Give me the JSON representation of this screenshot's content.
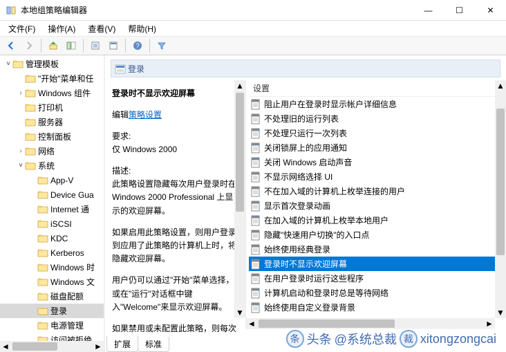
{
  "window": {
    "title": "本地组策略编辑器",
    "controls": {
      "min": "—",
      "max": "☐",
      "close": "✕"
    }
  },
  "menu": [
    {
      "label": "文件(F)"
    },
    {
      "label": "操作(A)"
    },
    {
      "label": "查看(V)"
    },
    {
      "label": "帮助(H)"
    }
  ],
  "toolbar": [
    {
      "name": "back-icon"
    },
    {
      "name": "forward-icon"
    },
    {
      "sep": true
    },
    {
      "name": "up-icon"
    },
    {
      "name": "show-hide-tree-icon"
    },
    {
      "sep": true
    },
    {
      "name": "export-list-icon"
    },
    {
      "name": "properties-icon"
    },
    {
      "sep": true
    },
    {
      "name": "help-icon"
    },
    {
      "sep": true
    },
    {
      "name": "filter-icon"
    }
  ],
  "tree": [
    {
      "indent": 0,
      "twisty": "open",
      "label": "管理模板"
    },
    {
      "indent": 1,
      "twisty": "none",
      "label": "\"开始\"菜单和任"
    },
    {
      "indent": 1,
      "twisty": "closed",
      "label": "Windows 组件"
    },
    {
      "indent": 1,
      "twisty": "none",
      "label": "打印机"
    },
    {
      "indent": 1,
      "twisty": "none",
      "label": "服务器"
    },
    {
      "indent": 1,
      "twisty": "none",
      "label": "控制面板"
    },
    {
      "indent": 1,
      "twisty": "closed",
      "label": "网络"
    },
    {
      "indent": 1,
      "twisty": "open",
      "label": "系统"
    },
    {
      "indent": 2,
      "twisty": "none",
      "label": "App-V"
    },
    {
      "indent": 2,
      "twisty": "none",
      "label": "Device Gua"
    },
    {
      "indent": 2,
      "twisty": "none",
      "label": "Internet 通"
    },
    {
      "indent": 2,
      "twisty": "none",
      "label": "iSCSI"
    },
    {
      "indent": 2,
      "twisty": "none",
      "label": "KDC"
    },
    {
      "indent": 2,
      "twisty": "none",
      "label": "Kerberos"
    },
    {
      "indent": 2,
      "twisty": "none",
      "label": "Windows 时"
    },
    {
      "indent": 2,
      "twisty": "none",
      "label": "Windows 文"
    },
    {
      "indent": 2,
      "twisty": "none",
      "label": "磁盘配额"
    },
    {
      "indent": 2,
      "twisty": "none",
      "label": "登录",
      "selected": true
    },
    {
      "indent": 2,
      "twisty": "none",
      "label": "电源管理"
    },
    {
      "indent": 2,
      "twisty": "none",
      "label": "访问被拒绝"
    }
  ],
  "panel": {
    "heading": "登录",
    "description": {
      "title": "登录时不显示欢迎屏幕",
      "edit_prefix": "编辑",
      "edit_link": "策略设置",
      "req_label": "要求:",
      "req_value": "仅 Windows 2000",
      "desc_label": "描述:",
      "desc_p1": "此策略设置隐藏每次用户登录时在 Windows 2000 Professional 上显示的欢迎屏幕。",
      "desc_p2": "如果启用此策略设置，则用户登录到应用了此策略的计算机上时，将隐藏欢迎屏幕。",
      "desc_p3": "用户仍可以通过\"开始\"菜单选择，或在\"运行\"对话框中键入\"Welcome\"来显示欢迎屏幕。",
      "desc_p4": "如果禁用或未配置此策略，则每次"
    },
    "list_header": "设置",
    "list": [
      {
        "label": "阻止用户在登录时显示帐户详细信息"
      },
      {
        "label": "不处理旧的运行列表"
      },
      {
        "label": "不处理只运行一次列表"
      },
      {
        "label": "关闭锁屏上的应用通知"
      },
      {
        "label": "关闭 Windows 启动声音"
      },
      {
        "label": "不显示网络选择 UI"
      },
      {
        "label": "不在加入域的计算机上枚举连接的用户"
      },
      {
        "label": "显示首次登录动画"
      },
      {
        "label": "在加入域的计算机上枚举本地用户"
      },
      {
        "label": "隐藏\"快速用户切换\"的入口点"
      },
      {
        "label": "始终使用经典登录"
      },
      {
        "label": "登录时不显示欢迎屏幕",
        "selected": true
      },
      {
        "label": "在用户登录时运行这些程序"
      },
      {
        "label": "计算机启动和登录时总是等待网络"
      },
      {
        "label": "始终使用自定义登录背景"
      }
    ],
    "tabs": {
      "extended": "扩展",
      "standard": "标准"
    }
  },
  "watermark": {
    "prefix": "头条",
    "handle": "@系统总裁",
    "site": "xitongzongcai"
  }
}
